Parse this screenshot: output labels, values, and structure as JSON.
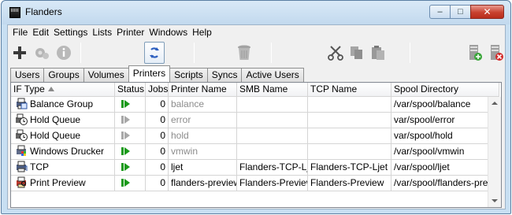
{
  "window": {
    "title": "Flanders",
    "minimize": "–",
    "maximize": "□",
    "close": "✕"
  },
  "menu": [
    "File",
    "Edit",
    "Settings",
    "Lists",
    "Printer",
    "Windows",
    "Help"
  ],
  "toolbar": [
    "add-icon",
    "settings-icon",
    "info-icon",
    "refresh-icon",
    "trash-icon",
    "cut-icon",
    "copy-icon",
    "paste-icon",
    "server-add-icon",
    "server-remove-icon"
  ],
  "tabs": [
    "Users",
    "Groups",
    "Volumes",
    "Printers",
    "Scripts",
    "Syncs",
    "Active Users"
  ],
  "selected_tab": "Printers",
  "columns": [
    "IF Type",
    "Status",
    "Jobs",
    "Printer Name",
    "SMB Name",
    "TCP Name",
    "Spool Directory"
  ],
  "rows": [
    {
      "type": "Balance Group",
      "icon": "balance-group-icon",
      "status": "active",
      "jobs": "0",
      "printer": "balance",
      "printer_gray": true,
      "smb": "",
      "tcp": "",
      "spool": "/var/spool/balance"
    },
    {
      "type": "Hold Queue",
      "icon": "hold-queue-icon",
      "status": "inactive",
      "jobs": "0",
      "printer": "error",
      "printer_gray": true,
      "smb": "",
      "tcp": "",
      "spool": "var/spool/error"
    },
    {
      "type": "Hold Queue",
      "icon": "hold-queue-icon",
      "status": "inactive",
      "jobs": "0",
      "printer": "hold",
      "printer_gray": true,
      "smb": "",
      "tcp": "",
      "spool": "var/spool/hold"
    },
    {
      "type": "Windows Drucker",
      "icon": "windows-printer-icon",
      "status": "active",
      "jobs": "0",
      "printer": "vmwin",
      "printer_gray": true,
      "smb": "",
      "tcp": "",
      "spool": "/var/spool/vmwin"
    },
    {
      "type": "TCP",
      "icon": "tcp-printer-icon",
      "status": "active",
      "jobs": "0",
      "printer": "ljet",
      "printer_gray": false,
      "smb": "Flanders-TCP-Ljet",
      "tcp": "Flanders-TCP-Ljet",
      "spool": "/var/spool/ljet"
    },
    {
      "type": "Print Preview",
      "icon": "print-preview-icon",
      "status": "active",
      "jobs": "0",
      "printer": "flanders-preview",
      "printer_gray": false,
      "smb": "Flanders-Preview",
      "tcp": "Flanders-Preview",
      "spool": "/var/spool/flanders-preview"
    }
  ],
  "colors": {
    "active": "#1a9a1a",
    "inactive": "#a8a8a8",
    "gray_text": "#8c8c8c",
    "window_frame": "#c8dff2"
  }
}
